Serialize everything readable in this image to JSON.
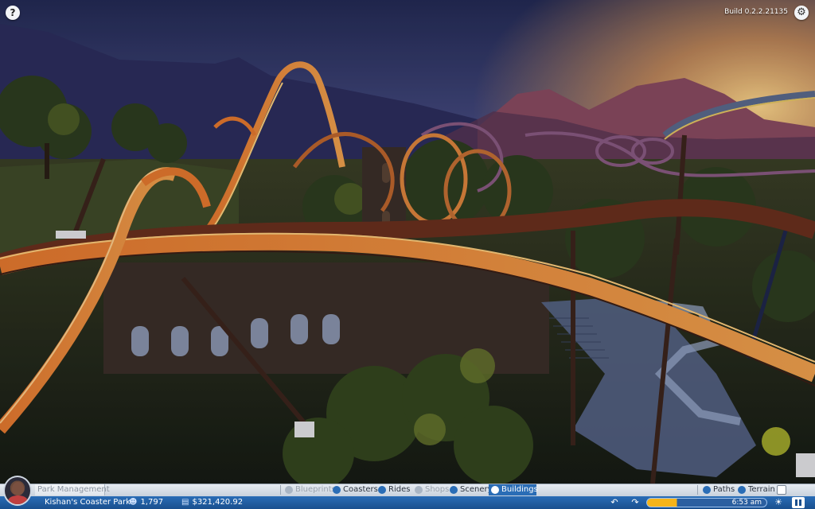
{
  "header": {
    "help_icon": "?",
    "build_version": "Build 0.2.2.21135",
    "settings_icon": "⚙"
  },
  "toolbar": {
    "park_management_label": "Park Management",
    "tabs": [
      {
        "label": "Blueprints",
        "icon": "blueprint-icon",
        "state": "disabled"
      },
      {
        "label": "Coasters",
        "icon": "coaster-icon",
        "state": "normal"
      },
      {
        "label": "Rides",
        "icon": "ride-icon",
        "state": "normal"
      },
      {
        "label": "Shops",
        "icon": "shop-icon",
        "state": "disabled"
      },
      {
        "label": "Scenery",
        "icon": "scenery-icon",
        "state": "normal"
      },
      {
        "label": "Buildings",
        "icon": "building-icon",
        "state": "active"
      },
      {
        "label": "Paths",
        "icon": "paths-icon",
        "state": "normal"
      },
      {
        "label": "Terrain",
        "icon": "terrain-icon",
        "state": "normal"
      }
    ]
  },
  "status_bar": {
    "park_name": "Kishan's Coaster Park",
    "guest_count": "1,797",
    "money": "$321,420.92",
    "time": "6:53 am",
    "time_of_day_fill": 0.25,
    "undo_icon": "↶",
    "redo_icon": "↷",
    "pause_icon": "pause-icon"
  },
  "colors": {
    "toolbar_light": "#dfe5ec",
    "status_blue": "#1a4f8e",
    "active_tab": "#2a6db6",
    "sun": "#f5b41a"
  }
}
